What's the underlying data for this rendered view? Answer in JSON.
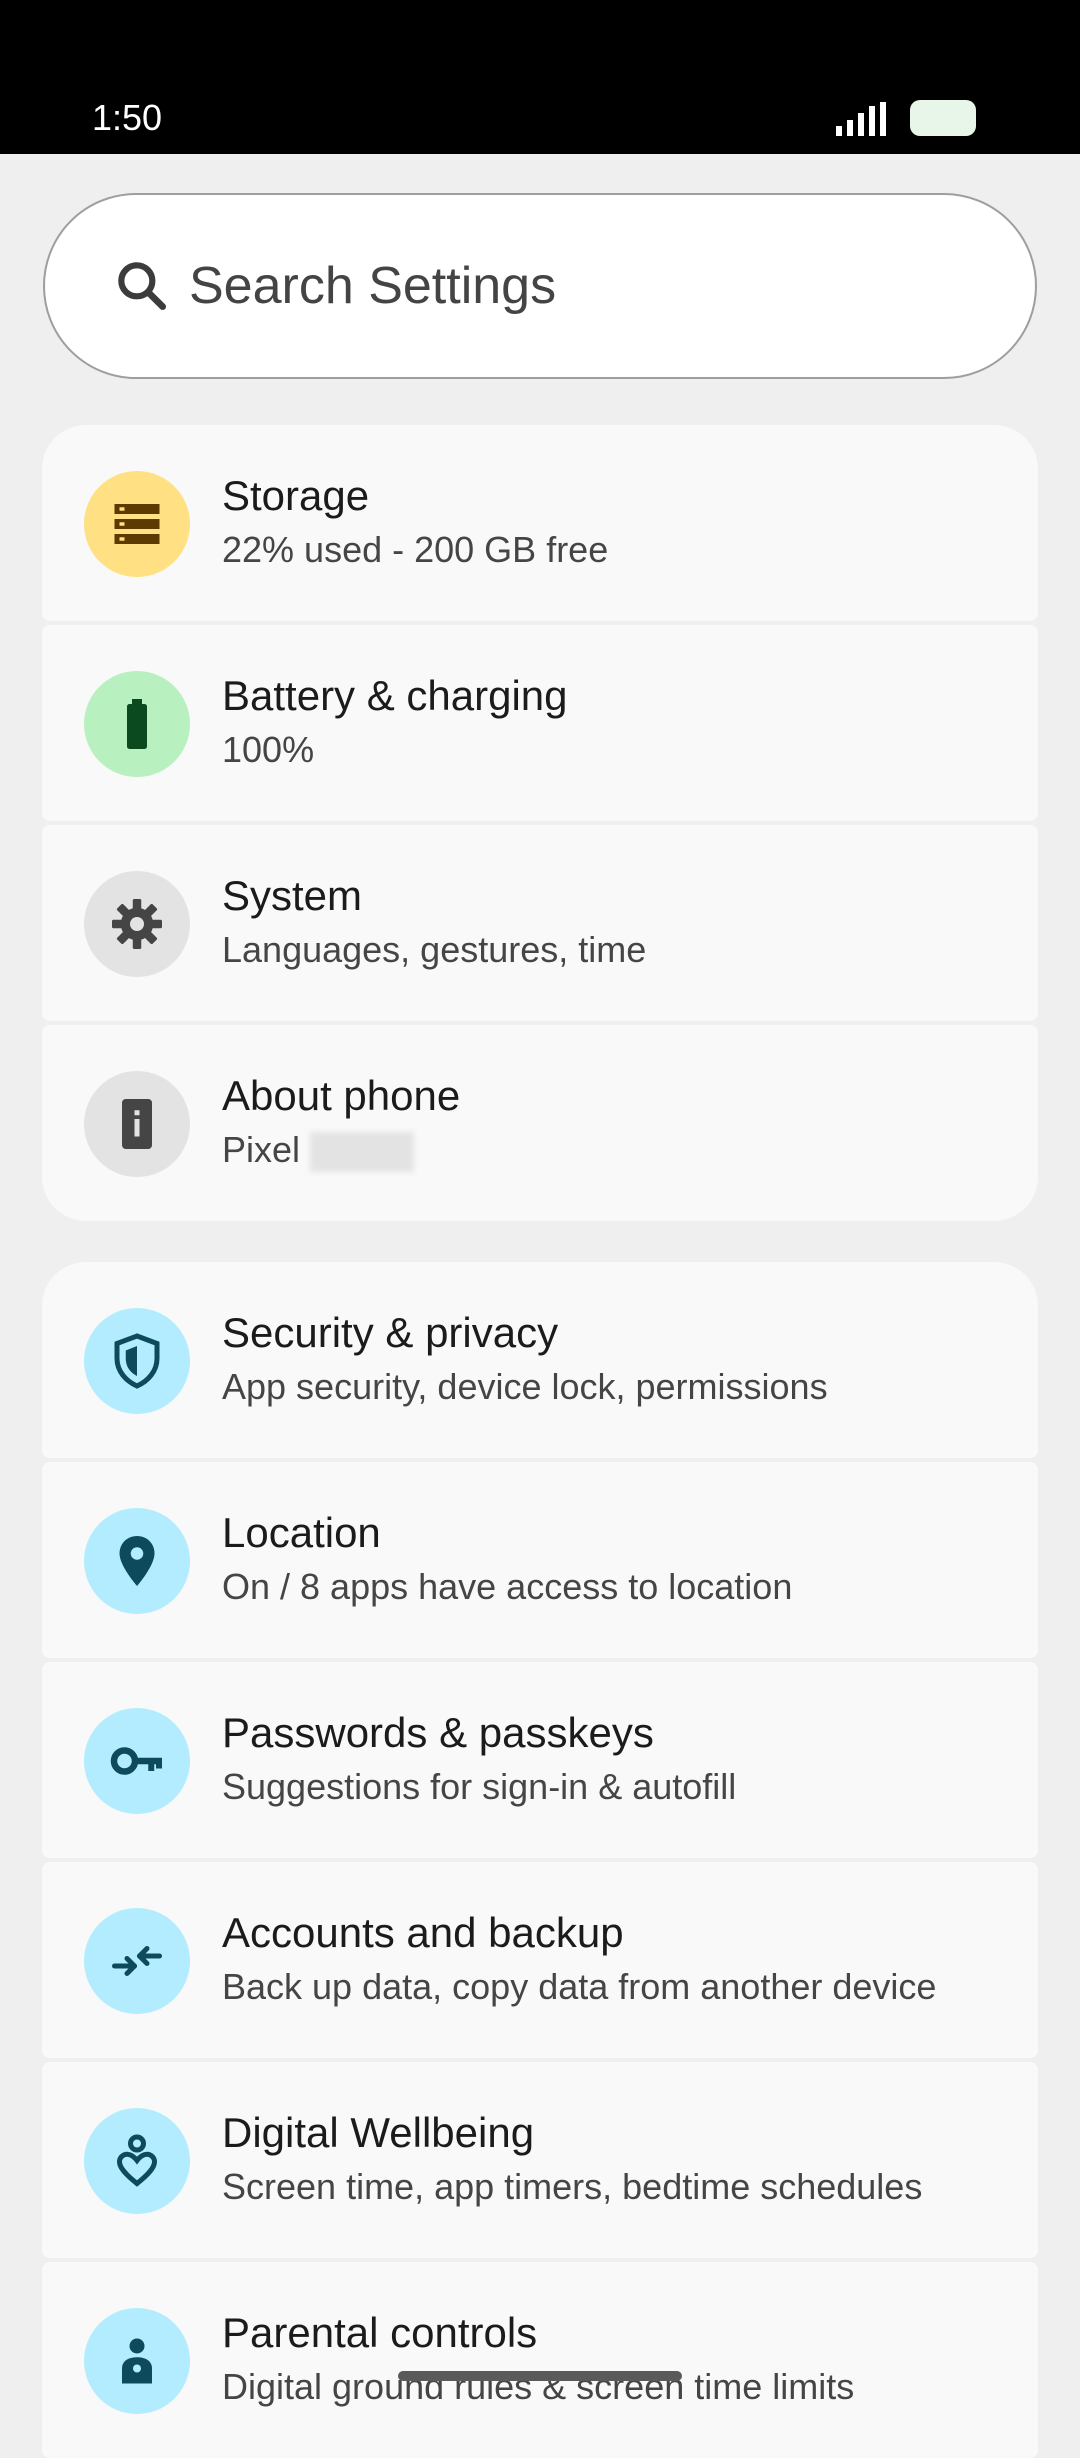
{
  "status_bar": {
    "time": "1:50",
    "signal_icon": "signal-icon",
    "battery_icon": "battery-icon"
  },
  "search": {
    "placeholder": "Search Settings",
    "icon": "search-icon"
  },
  "groups": [
    {
      "items": [
        {
          "title": "Storage",
          "subtitle": "22% used - 200 GB free",
          "icon": "storage-icon",
          "icon_bg": "#ffe082",
          "icon_color": "#5d3a00"
        },
        {
          "title": "Battery & charging",
          "subtitle": "100%",
          "icon": "battery-icon",
          "icon_bg": "#b9f0c0",
          "icon_color": "#0b4a1f"
        },
        {
          "title": "System",
          "subtitle": "Languages, gestures, time",
          "icon": "gear-icon",
          "icon_bg": "#e3e3e3",
          "icon_color": "#454545"
        },
        {
          "title": "About phone",
          "subtitle": "Pixel",
          "icon": "phone-info-icon",
          "icon_bg": "#e3e3e3",
          "icon_color": "#454545"
        }
      ]
    },
    {
      "items": [
        {
          "title": "Security & privacy",
          "subtitle": "App security, device lock, permissions",
          "icon": "shield-icon",
          "icon_bg": "#b3ecff",
          "icon_color": "#0d4b5c"
        },
        {
          "title": "Location",
          "subtitle": "On / 8 apps have access to location",
          "icon": "location-pin-icon",
          "icon_bg": "#b3ecff",
          "icon_color": "#0d4b5c"
        },
        {
          "title": "Passwords & passkeys",
          "subtitle": "Suggestions for sign-in & autofill",
          "icon": "key-icon",
          "icon_bg": "#b3ecff",
          "icon_color": "#0d4b5c"
        },
        {
          "title": "Accounts and backup",
          "subtitle": "Back up data, copy data from another device",
          "icon": "sync-arrows-icon",
          "icon_bg": "#b3ecff",
          "icon_color": "#0d4b5c"
        },
        {
          "title": "Digital Wellbeing",
          "subtitle": "Screen time, app timers, bedtime schedules",
          "icon": "wellbeing-heart-icon",
          "icon_bg": "#b3ecff",
          "icon_color": "#0d4b5c"
        },
        {
          "title": "Parental controls",
          "subtitle": "Digital ground rules & screen time limits",
          "icon": "parental-controls-icon",
          "icon_bg": "#b3ecff",
          "icon_color": "#0d4b5c"
        }
      ]
    }
  ]
}
